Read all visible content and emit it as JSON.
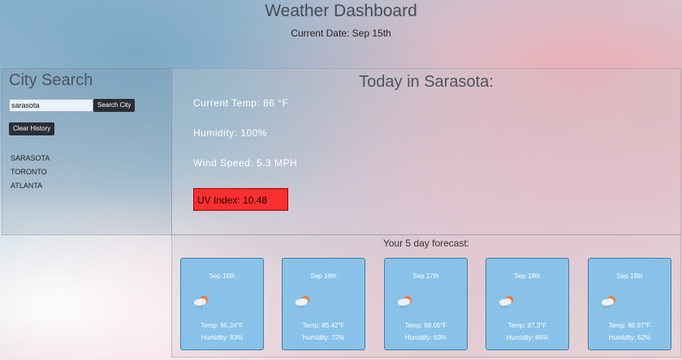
{
  "header": {
    "title": "Weather Dashboard",
    "date_line": "Current Date: Sep 15th"
  },
  "search": {
    "title": "City Search",
    "input_value": "sarasota",
    "search_button": "Search City",
    "clear_button": "Clear History",
    "history": [
      "SARASOTA",
      "TORONTO",
      "ATLANTA"
    ]
  },
  "today": {
    "title": "Today in Sarasota:",
    "temp": "Current Temp: 86 °F",
    "humidity": "Humidity: 100%",
    "wind": "Wind Speed: 5.3 MPH",
    "uv": "UV Index: 10.48",
    "uv_color": "#fa2f2f"
  },
  "forecast": {
    "title": "Your 5 day forecast:",
    "icon": "cloud-sun-rain-icon",
    "days": [
      {
        "date": "Sep 15th",
        "temp": "Temp: 85.24°F",
        "humidity": "Humidity: 83%"
      },
      {
        "date": "Sep 16th",
        "temp": "Temp: 85.42°F",
        "humidity": "Humidity: 72%"
      },
      {
        "date": "Sep 17th",
        "temp": "Temp: 88.05°F",
        "humidity": "Humidity: 63%"
      },
      {
        "date": "Sep 18th",
        "temp": "Temp: 87.3°F",
        "humidity": "Humidity: 66%"
      },
      {
        "date": "Sep 19th",
        "temp": "Temp: 86.97°F",
        "humidity": "Humidity: 62%"
      }
    ]
  }
}
